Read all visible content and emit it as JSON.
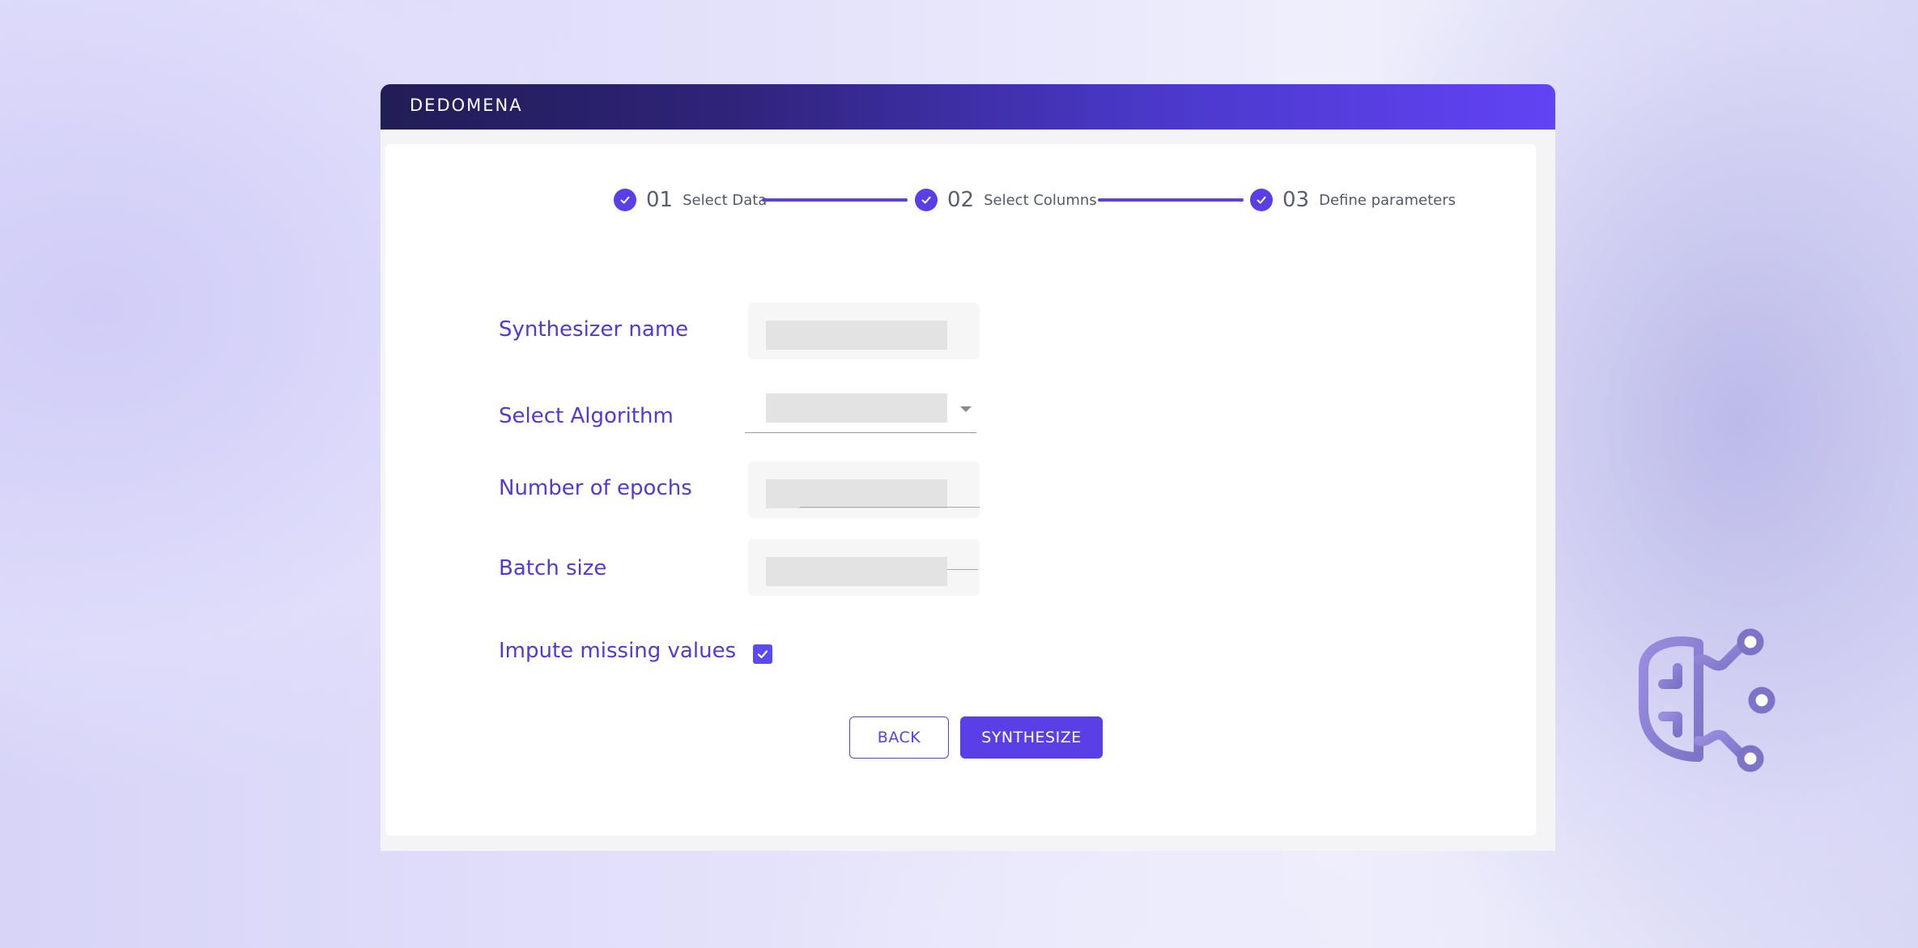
{
  "brand": {
    "logo_text": "DEDOMENA"
  },
  "stepper": {
    "steps": [
      {
        "number": "01",
        "label": "Select Data",
        "status": "completed"
      },
      {
        "number": "02",
        "label": "Select Columns",
        "status": "completed"
      },
      {
        "number": "03",
        "label": "Define parameters",
        "status": "completed"
      }
    ]
  },
  "form": {
    "synthesizer_name": {
      "label": "Synthesizer name",
      "value": ""
    },
    "algorithm": {
      "label": "Select Algorithm",
      "selected": ""
    },
    "epochs": {
      "label": "Number of epochs",
      "value": ""
    },
    "batch_size": {
      "label": "Batch size",
      "value": ""
    },
    "impute": {
      "label": "Impute missing values",
      "checked": true
    }
  },
  "actions": {
    "back_label": "BACK",
    "synthesize_label": "SYNTHESIZE"
  },
  "colors": {
    "accent": "#5a3ee6",
    "label": "#5638d6",
    "header_start": "#211d55",
    "header_end": "#6243f5",
    "icon": "#8a7fd6"
  },
  "icons": {
    "step_check": "check-circle-icon",
    "decoration": "brain-circuit-icon"
  }
}
